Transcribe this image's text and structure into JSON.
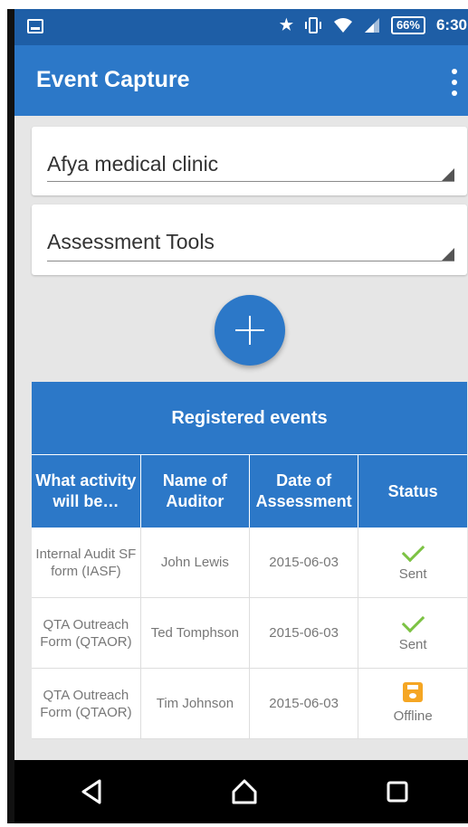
{
  "status_bar": {
    "battery": "66%",
    "time": "6:30",
    "icons": [
      "image-icon",
      "star-icon",
      "vibrate-icon",
      "wifi-icon",
      "signal-icon",
      "battery-icon"
    ]
  },
  "app_bar": {
    "title": "Event Capture",
    "menu_icon": "more-vert-icon"
  },
  "org_unit_select": {
    "value": "Afya medical clinic"
  },
  "program_select": {
    "value": "Assessment Tools"
  },
  "fab": {
    "icon": "plus-icon"
  },
  "events_table": {
    "title": "Registered events",
    "columns": [
      "What activity will be…",
      "Name of Auditor",
      "Date of Assessment",
      "Status"
    ],
    "rows": [
      {
        "activity": "Internal Audit SF form (IASF)",
        "auditor": "John Lewis",
        "date": "2015-06-03",
        "status": "Sent",
        "status_icon": "check-icon"
      },
      {
        "activity": "QTA Outreach Form (QTAOR)",
        "auditor": "Ted Tomphson",
        "date": "2015-06-03",
        "status": "Sent",
        "status_icon": "check-icon"
      },
      {
        "activity": "QTA Outreach Form (QTAOR)",
        "auditor": "Tim Johnson",
        "date": "2015-06-03",
        "status": "Offline",
        "status_icon": "save-icon"
      }
    ]
  },
  "nav_bar": {
    "buttons": [
      "back-icon",
      "home-icon",
      "recents-icon"
    ]
  },
  "colors": {
    "primary": "#2c78c8",
    "status_bar": "#1e5ea6",
    "sent": "#7cc243",
    "offline": "#f5a623"
  }
}
